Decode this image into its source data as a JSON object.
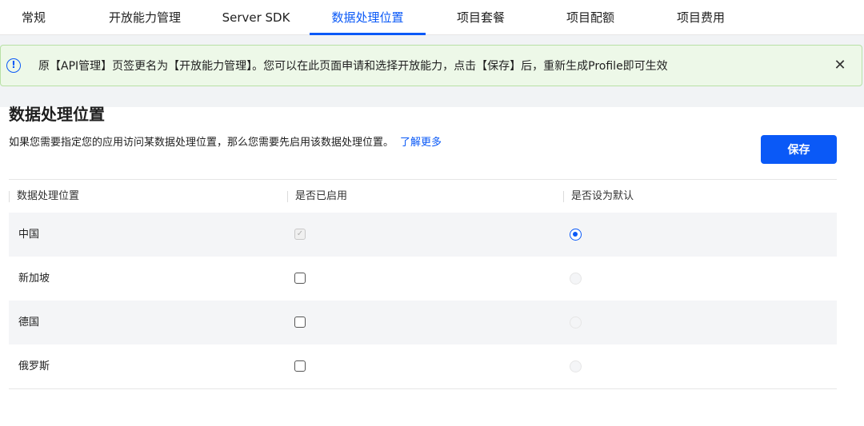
{
  "tabs": [
    {
      "label": "常规"
    },
    {
      "label": "开放能力管理"
    },
    {
      "label": "Server SDK"
    },
    {
      "label": "数据处理位置"
    },
    {
      "label": "项目套餐"
    },
    {
      "label": "项目配额"
    },
    {
      "label": "项目费用"
    }
  ],
  "active_tab": "数据处理位置",
  "notice": {
    "icon": "info-circle-icon",
    "text": "原【API管理】页签更名为【开放能力管理】。您可以在此页面申请和选择开放能力，点击【保存】后，重新生成Profile即可生效",
    "close_icon": "close-icon",
    "close_glyph": "✕",
    "info_glyph": "!"
  },
  "page": {
    "title": "数据处理位置",
    "description": "如果您需要指定您的应用访问某数据处理位置，那么您需要先启用该数据处理位置。",
    "learn_more": "了解更多",
    "save_label": "保存"
  },
  "table": {
    "headers": [
      "数据处理位置",
      "是否已启用",
      "是否设为默认"
    ],
    "rows": [
      {
        "name": "中国",
        "enabled": true,
        "enabled_disabled": true,
        "default": true
      },
      {
        "name": "新加坡",
        "enabled": false,
        "enabled_disabled": false,
        "default": false
      },
      {
        "name": "德国",
        "enabled": false,
        "enabled_disabled": false,
        "default": false
      },
      {
        "name": "俄罗斯",
        "enabled": false,
        "enabled_disabled": false,
        "default": false
      }
    ],
    "check_glyph": "✓"
  },
  "colors": {
    "accent": "#0a59f7",
    "notice_bg": "#edf8e8",
    "notice_border": "#b8e0a6",
    "row_stripe": "#f4f5f7"
  }
}
